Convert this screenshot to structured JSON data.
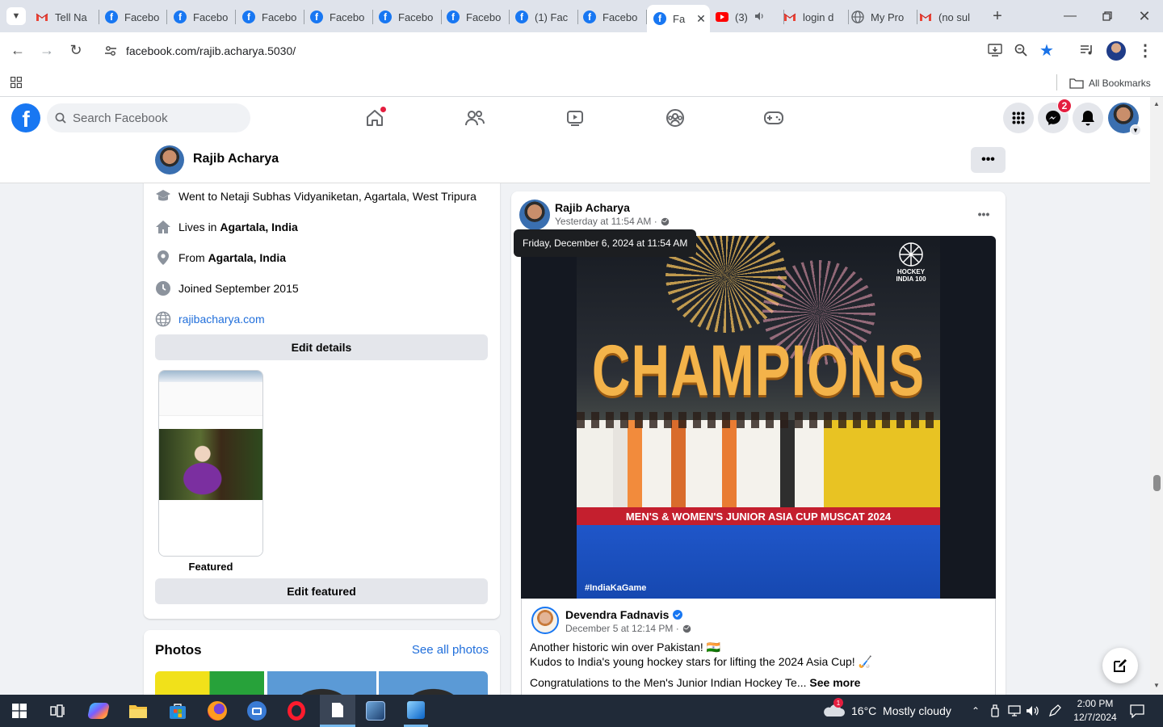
{
  "tabs": [
    {
      "title": "Tell Na",
      "icon": "gmail-icon"
    },
    {
      "title": "Facebo",
      "icon": "facebook-icon"
    },
    {
      "title": "Facebo",
      "icon": "facebook-icon"
    },
    {
      "title": "Facebo",
      "icon": "facebook-icon"
    },
    {
      "title": "Facebo",
      "icon": "facebook-icon"
    },
    {
      "title": "Facebo",
      "icon": "facebook-icon"
    },
    {
      "title": "Facebo",
      "icon": "facebook-icon"
    },
    {
      "title": "(1) Fac",
      "icon": "facebook-icon"
    },
    {
      "title": "Facebo",
      "icon": "facebook-icon"
    },
    {
      "title": "Fa",
      "icon": "facebook-icon",
      "active": true
    },
    {
      "title": "(3)",
      "icon": "youtube-icon"
    },
    {
      "title": "login d",
      "icon": "gmail-icon"
    },
    {
      "title": "My Pro",
      "icon": "globe-icon"
    },
    {
      "title": "(no sul",
      "icon": "gmail-icon"
    }
  ],
  "browser": {
    "url": "facebook.com/rajib.acharya.5030/",
    "all_bookmarks": "All Bookmarks"
  },
  "fb": {
    "search_placeholder": "Search Facebook",
    "messenger_badge": "2"
  },
  "profile": {
    "name": "Rajib Acharya"
  },
  "intro": {
    "education": "Went to Netaji Subhas Vidyaniketan, Agartala, West Tripura",
    "lives_prefix": "Lives in ",
    "lives_place": "Agartala, India",
    "from_prefix": "From ",
    "from_place": "Agartala, India",
    "joined": "Joined September 2015",
    "website": "rajibacharya.com",
    "edit_details": "Edit details",
    "featured_label": "Featured",
    "edit_featured": "Edit featured"
  },
  "photos": {
    "title": "Photos",
    "see_all": "See all photos"
  },
  "post": {
    "author": "Rajib Acharya",
    "time": "Yesterday at 11:54 AM ·",
    "tooltip": "Friday, December 6, 2024 at 11:54 AM",
    "image": {
      "headline": "CHAMPIONS",
      "banner": "MEN'S & WOMEN'S JUNIOR ASIA CUP MUSCAT 2024",
      "hashtag": "#IndiaKaGame",
      "logo_text": "HOCKEY INDIA 100"
    },
    "shared": {
      "author": "Devendra Fadnavis",
      "time": "December 5 at 12:14 PM ·",
      "line1": "Another historic win over Pakistan! 🇮🇳",
      "line2": "Kudos to India's young hockey stars for lifting the 2024 Asia Cup! 🏑",
      "line3": "Congratulations to the Men's Junior Indian Hockey Te...",
      "see_more": "See more"
    }
  },
  "taskbar": {
    "weather": "16°C  Mostly cloudy",
    "weather_badge": "1",
    "time": "2:00 PM",
    "date": "12/7/2024"
  },
  "colors": {
    "fb_blue": "#1877f2",
    "tab_bar": "#dfe3eb",
    "taskbar": "#202a38",
    "badge_red": "#e41e3f"
  }
}
